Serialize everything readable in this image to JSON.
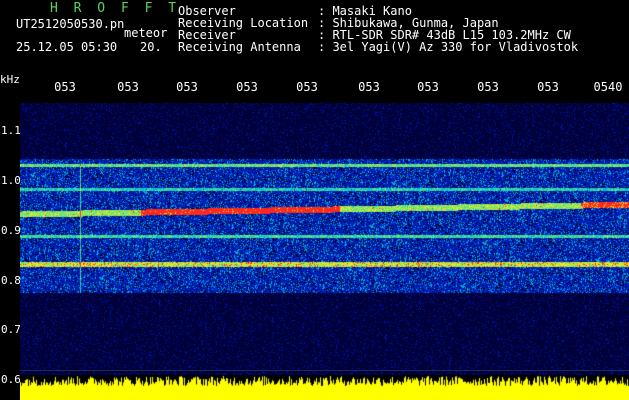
{
  "header": {
    "app_title": "H R O F F T",
    "filename": "UT2512050530.pn",
    "type_label": "meteor",
    "date": "25.12.05 05:30",
    "duration": "20.",
    "fields": [
      {
        "label": "Observer",
        "value": ": Masaki Kano"
      },
      {
        "label": "Receiving Location",
        "value": ": Shibukawa, Gunma, Japan"
      },
      {
        "label": "Receiver",
        "value": ": RTL-SDR SDR# 43dB L15 103.2MHz CW"
      },
      {
        "label": "Receiving Antenna",
        "value": ": 3el Yagi(V) Az 330 for Vladivostok"
      }
    ]
  },
  "axis": {
    "y_unit": "kHz",
    "y_ticks": [
      "1.1",
      "1.0",
      "0.9",
      "0.8",
      "0.7",
      "0.6"
    ],
    "x_ticks": [
      "053",
      "053",
      "053",
      "053",
      "053",
      "053",
      "053",
      "053",
      "053",
      "0540"
    ]
  },
  "colors": {
    "background": "#000000",
    "title": "#5bd35b",
    "tick_label": "#ffffff",
    "spectrum_bg": "#00003a",
    "level_bars": "#ffff00"
  }
}
